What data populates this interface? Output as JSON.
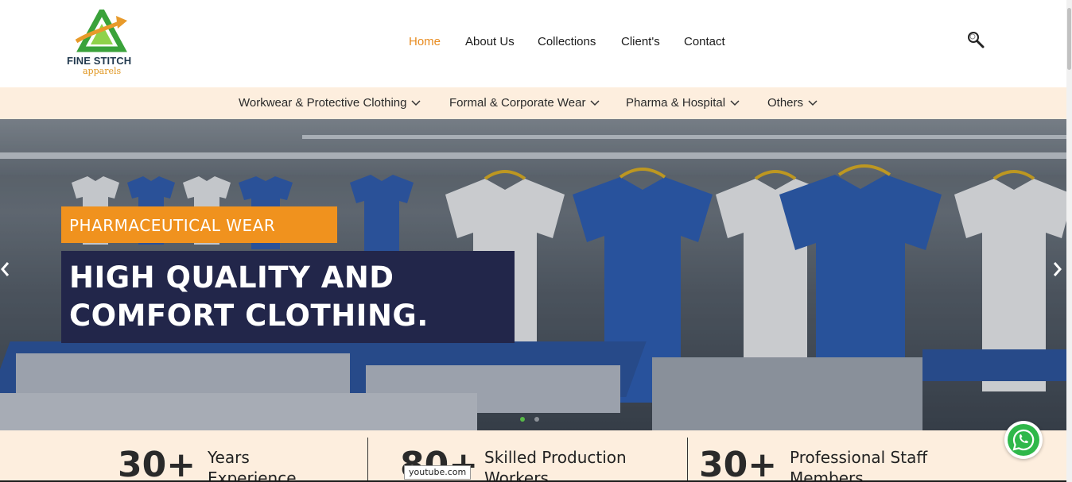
{
  "brand": {
    "name": "FINE STITCH",
    "subtitle": "apparels",
    "colors": {
      "green": "#3aa23a",
      "orange": "#f0921e",
      "navy": "#223a4f"
    }
  },
  "main_nav": {
    "items": [
      {
        "label": "Home",
        "active": true
      },
      {
        "label": "About Us",
        "active": false
      },
      {
        "label": "Collections",
        "active": false
      },
      {
        "label": "Client's",
        "active": false
      },
      {
        "label": "Contact",
        "active": false
      }
    ],
    "active_color": "#e88b1f",
    "search_icon": "search-icon"
  },
  "sub_nav": {
    "items": [
      {
        "label": "Workwear & Protective Clothing",
        "icon": "chevron-down-icon"
      },
      {
        "label": "Formal & Corporate Wear",
        "icon": "chevron-down-icon"
      },
      {
        "label": "Pharma & Hospital",
        "icon": "chevron-down-icon"
      },
      {
        "label": "Others",
        "icon": "chevron-down-icon"
      }
    ],
    "background": "#fdeede"
  },
  "hero": {
    "tag": "PHARMACEUTICAL WEAR",
    "headline_line1": "HIGH QUALITY AND",
    "headline_line2": "COMFORT CLOTHING.",
    "tag_color": "#f0921e",
    "headline_bg": "#22264a",
    "slides_total": 2,
    "active_slide": 1,
    "prev_icon": "chevron-left-icon",
    "next_icon": "chevron-right-icon"
  },
  "stats": [
    {
      "number": "30+",
      "label_line1": "Years",
      "label_line2": "Experience"
    },
    {
      "number": "80+",
      "label_line1": "Skilled Production",
      "label_line2": "Workers"
    },
    {
      "number": "30+",
      "label_line1": "Professional Staff",
      "label_line2": "Members"
    }
  ],
  "tooltip": "youtube.com",
  "whatsapp_icon": "whatsapp-icon"
}
